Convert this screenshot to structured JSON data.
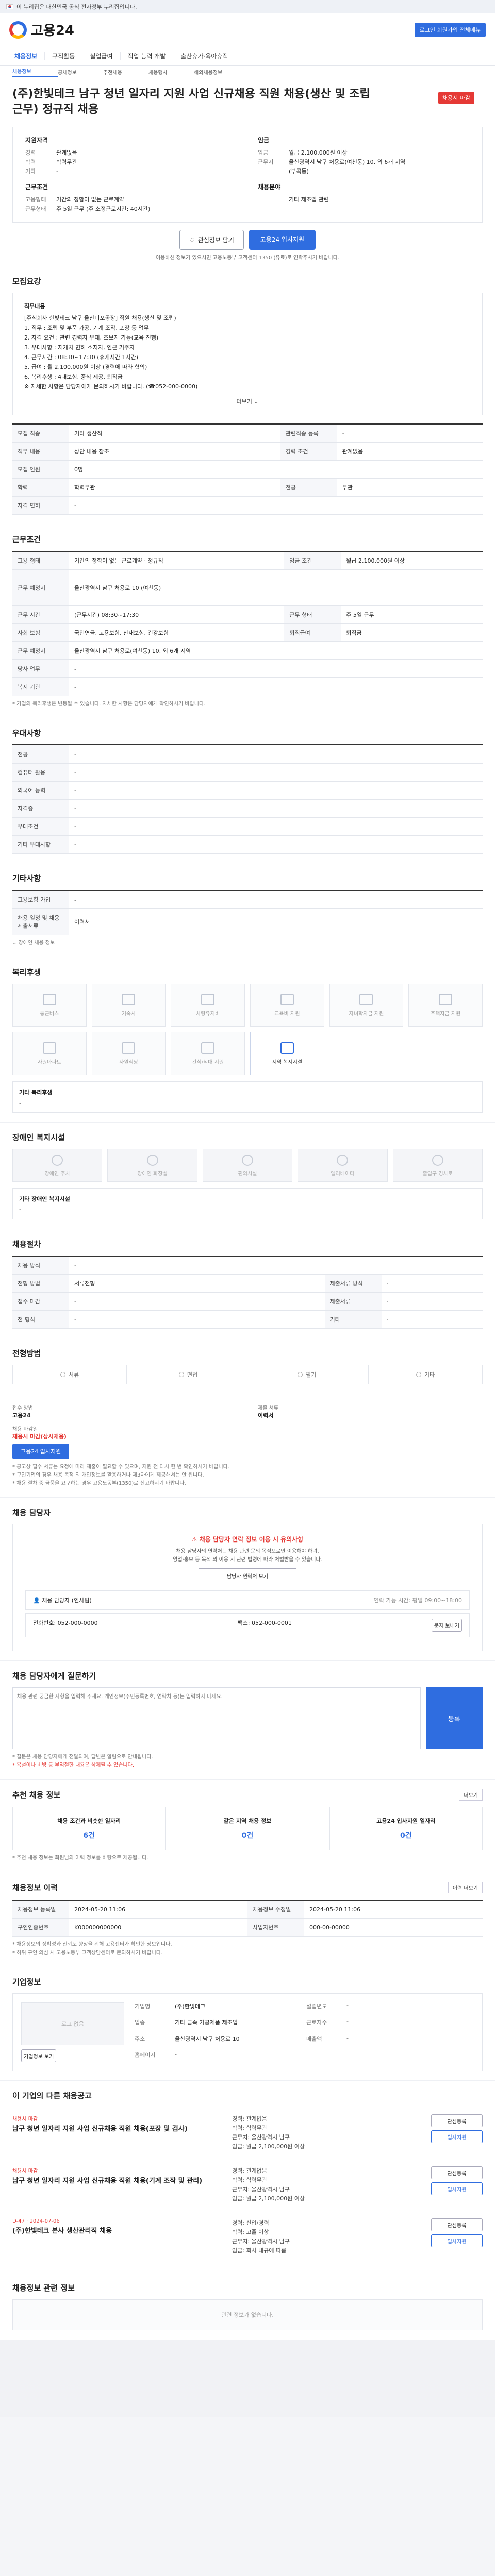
{
  "gov_banner": {
    "text": "이 누리집은 대한민국 공식 전자정부 누리집입니다.",
    "more": ""
  },
  "header": {
    "logo_text": "고용24",
    "login_label": "로그인 회원가입 전체메뉴"
  },
  "gnb": {
    "items": [
      "채용정보",
      "구직활동",
      "실업급여",
      "직업 능력 개발",
      "출산휴가·육아휴직"
    ]
  },
  "subnav": {
    "items": [
      "채용정보",
      "공채정보",
      "추천채용",
      "채용행사",
      "해외채용정보"
    ]
  },
  "job": {
    "title": "(주)한빛테크 남구 청년 일자리 지원 사업 신규채용 직원 채용(생산 및 조립 근무) 정규직 채용",
    "deadline": "채용시 마감"
  },
  "summary": {
    "left_title": "지원자격",
    "left_rows": [
      {
        "k": "경력",
        "v": "관계없음"
      },
      {
        "k": "학력",
        "v": "학력무관"
      },
      {
        "k": "기타",
        "v": "-"
      }
    ],
    "left2_title": "근무조건",
    "left2_rows": [
      {
        "k": "고용형태",
        "v": "기간의 정함이 없는 근로계약"
      },
      {
        "k": "근무형태",
        "v": "주 5일 근무 (주 소정근로시간: 40시간)"
      }
    ],
    "right_title": "임금",
    "right_rows": [
      {
        "k": "임금",
        "v": "월급 2,100,000원 이상"
      },
      {
        "k": "근무지",
        "v": "울산광역시 남구 처용로(여천동) 10, 외 6개 지역"
      },
      {
        "k": "",
        "v": "(부곡동)"
      }
    ],
    "right2_title": "채용분야",
    "right2_rows": [
      {
        "k": "",
        "v": "기타 제조업 관련"
      }
    ],
    "btn_scrap": "관심정보 담기",
    "btn_apply": "고용24 입사지원",
    "notice": "이용하신 정보가 있으시면 고용노동부 고객센터 1350 (유료)로 연락주시기 바랍니다."
  },
  "recruit": {
    "title": "모집요강",
    "desc_head": "직무내용",
    "desc_lines": [
      "[주식회사 한빛테크 남구 울산미포공장] 직원 채용(생산 및 조립)",
      "1. 직무 : 조립 및 부품 가공, 기계 조작, 포장 등 업무",
      "2. 자격 요건 : 관련 경력자 우대, 초보자 가능(교육 진행)",
      "3. 우대사항 : 지게차 면허 소지자, 인근 거주자",
      "4. 근무시간 : 08:30~17:30 (휴게시간 1시간)",
      "5. 급여 : 월 2,100,000원 이상 (경력에 따라 협의)",
      "6. 복리후생 : 4대보험, 중식 제공, 퇴직금",
      "※ 자세한 사항은 담당자에게 문의하시기 바랍니다. (☎052-000-0000)"
    ],
    "toggle": "더보기",
    "rows": [
      {
        "k": "모집 직종",
        "v": "기타 생산직",
        "k2": "관련직종 등록",
        "v2": "-"
      },
      {
        "k": "직무 내용",
        "v": "상단 내용 참조",
        "k2": "경력 조건",
        "v2": "관계없음"
      },
      {
        "k": "모집 인원",
        "v": "0명",
        "k2": "",
        "v2": ""
      },
      {
        "k": "학력",
        "v": "학력무관",
        "k2": "전공",
        "v2": "무관"
      },
      {
        "k": "자격 면허",
        "v": "-",
        "k2": "",
        "v2": ""
      }
    ]
  },
  "conditions": {
    "title": "근무조건",
    "rows": [
      {
        "k": "고용 형태",
        "v": "기간의 정함이 없는 근로계약 · 정규직",
        "k2": "임금 조건",
        "v2": "월급 2,100,000원 이상"
      },
      {
        "k": "근무 예정지",
        "v": "울산광역시 남구 처용로 10 (여천동)",
        "k2": "",
        "v2": ""
      },
      {
        "k": "근무 시간",
        "v": "(근무시간) 08:30~17:30",
        "k2": "근무 형태",
        "v2": "주 5일 근무"
      },
      {
        "k": "사회 보험",
        "v": "국민연금, 고용보험, 산재보험, 건강보험",
        "k2": "퇴직급여",
        "v2": "퇴직금"
      },
      {
        "k": "근무 예정지",
        "v": "울산광역시 남구 처용로(여천동) 10, 외 6개 지역",
        "k2": "",
        "v2": ""
      },
      {
        "k": "당사 업무",
        "v": "-",
        "k2": "",
        "v2": ""
      },
      {
        "k": "복지 기관",
        "v": "-",
        "k2": "",
        "v2": ""
      }
    ],
    "footnote": "* 기업의 복리후생은 변동될 수 있습니다. 자세한 사항은 담당자에게 확인하시기 바랍니다."
  },
  "preference": {
    "title": "우대사항",
    "rows": [
      {
        "k": "전공",
        "v": "-"
      },
      {
        "k": "컴퓨터 활용",
        "v": "-"
      },
      {
        "k": "외국어 능력",
        "v": "-"
      },
      {
        "k": "자격증",
        "v": "-"
      },
      {
        "k": "우대조건",
        "v": "-"
      },
      {
        "k": "기타 우대사항",
        "v": "-"
      }
    ]
  },
  "other_cond": {
    "title": "기타사항",
    "rows": [
      {
        "k": "고용보험 가입",
        "v": "-"
      },
      {
        "k": "채용 일정 및 채용 제출서류",
        "v": "이력서"
      }
    ],
    "link": "장애인 채용 정보"
  },
  "facility": {
    "title": "복리후생",
    "items": [
      "통근버스",
      "기숙사",
      "차량유지비",
      "교육비 지원",
      "자녀학자금 지원",
      "주택자금 지원",
      "사원아파트",
      "사원식당",
      "간식/식대 지원",
      "지역 복지시설"
    ],
    "active_index": 9,
    "text_title": "기타 복리후생",
    "text": "-"
  },
  "welfare": {
    "title": "장애인 복지시설",
    "items": [
      "장애인 주차",
      "장애인 화장실",
      "편의시설",
      "엘리베이터",
      "출입구 경사로"
    ],
    "text_title": "기타 장애인 복지시설",
    "text": "-"
  },
  "hire": {
    "title": "채용절차",
    "rows": [
      {
        "k": "채용 방식",
        "v": "-"
      },
      {
        "k": "전형 방법",
        "v": "서류전형",
        "k2": "제출서류 방식",
        "v2": "-"
      },
      {
        "k": "접수 마감",
        "v": "-",
        "k2": "제출서류",
        "v2": "-"
      },
      {
        "k": "전 형식",
        "v": "-",
        "k2": "기타",
        "v2": "-"
      }
    ]
  },
  "method": {
    "title": "전형방법",
    "items": [
      "서류",
      "면접",
      "필기",
      "기타"
    ]
  },
  "apply": {
    "k1": "접수 방법",
    "v1": "고용24",
    "k2": "제출 서류",
    "v2": "이력서",
    "k3": "채용 마감일",
    "v3": "채용시 마감(상시채용)",
    "k4": "",
    "v4": "",
    "btn": "고용24 입사지원",
    "notes": [
      "* 공고상 필수 서류는 요청에 따라 제출이 필요할 수 있으며, 지원 전 다시 한 번 확인하시기 바랍니다.",
      "* 구인기업의 경우 채용 목적 외 개인정보를 활용하거나 제3자에게 제공해서는 안 됩니다.",
      "* 채용 절차 중 금품을 요구하는 경우 고용노동부(1350)로 신고하시기 바랍니다."
    ]
  },
  "manager": {
    "title": "채용 담당자",
    "alert": "채용 담당자 연락 정보 이용 시 유의사항",
    "text1": "채용 담당자의 연락처는 채용 관련 문의 목적으로만 이용해야 하며,",
    "text2": "영업·홍보 등 목적 외 이용 시 관련 법령에 따라 처벌받을 수 있습니다.",
    "btn": "담당자 연락처 보기",
    "name": "채용 담당자 (인사팀)",
    "name_note": "연락 가능 시간: 평일 09:00~18:00",
    "phone": "전화번호: 052-000-0000",
    "fax": "팩스: 052-000-0001",
    "msg": "문자 보내기"
  },
  "qa": {
    "title": "채용 담당자에게 질문하기",
    "placeholder": "채용 관련 궁금한 사항을 입력해 주세요. 개인정보(주민등록번호, 연락처 등)는 입력하지 마세요.",
    "btn": "등록",
    "note1": "* 질문은 채용 담당자에게 전달되며, 답변은 알림으로 안내됩니다.",
    "note2": "* 욕설이나 비방 등 부적절한 내용은 삭제될 수 있습니다."
  },
  "recommend": {
    "title": "추천 채용 정보",
    "link": "더보기",
    "cards": [
      {
        "t": "채용 조건과 비슷한 일자리",
        "c": "6건"
      },
      {
        "t": "같은 지역 채용 정보",
        "c": "0건"
      },
      {
        "t": "고용24 입사지원 일자리",
        "c": "0건"
      }
    ],
    "note": "* 추천 채용 정보는 회원님의 이력 정보를 바탕으로 제공됩니다."
  },
  "regist": {
    "title": "채용정보 이력",
    "link": "이력 더보기",
    "rows": [
      {
        "k": "채용정보 등록일",
        "v": "2024-05-20 11:06",
        "k2": "채용정보 수정일",
        "v2": "2024-05-20 11:06"
      },
      {
        "k": "구인인증번호",
        "v": "K000000000000",
        "k2": "사업자번호",
        "v2": "000-00-00000"
      }
    ],
    "notes": [
      "* 채용정보의 정확성과 신뢰도 향상을 위해 고용센터가 확인한 정보입니다.",
      "* 허위 구인 의심 시 고용노동부 고객상담센터로 문의하시기 바랍니다."
    ]
  },
  "company": {
    "title": "기업정보",
    "logo": "로고 없음",
    "btn": "기업정보 보기",
    "rows": [
      {
        "k": "기업명",
        "v": "(주)한빛테크",
        "k2": "설립년도",
        "v2": "-"
      },
      {
        "k": "업종",
        "v": "기타 금속 가공제품 제조업",
        "k2": "근로자수",
        "v2": "-"
      },
      {
        "k": "주소",
        "v": "울산광역시 남구 처용로 10",
        "k2": "매출액",
        "v2": "-"
      },
      {
        "k": "홈페이지",
        "v": "-",
        "k2": "",
        "v2": ""
      }
    ]
  },
  "others": {
    "title": "이 기업의 다른 채용공고",
    "items": [
      {
        "tag": "채용시 마감",
        "title": "남구 청년 일자리 지원 사업 신규채용 직원 채용(포장 및 검사)",
        "meta1": "경력: 관계없음",
        "meta2": "학력: 학력무관",
        "meta3": "근무지: 울산광역시 남구",
        "meta4": "임금: 월급 2,100,000원 이상",
        "btn1": "관심등록",
        "btn2": "입사지원"
      },
      {
        "tag": "채용시 마감",
        "title": "남구 청년 일자리 지원 사업 신규채용 직원 채용(기계 조작 및 관리)",
        "meta1": "경력: 관계없음",
        "meta2": "학력: 학력무관",
        "meta3": "근무지: 울산광역시 남구",
        "meta4": "임금: 월급 2,100,000원 이상",
        "btn1": "관심등록",
        "btn2": "입사지원"
      },
      {
        "tag": "D-47 · 2024-07-06",
        "title": "(주)한빛테크 본사 생산관리직 채용",
        "meta1": "경력: 신입/경력",
        "meta2": "학력: 고졸 이상",
        "meta3": "근무지: 울산광역시 남구",
        "meta4": "임금: 회사 내규에 따름",
        "btn1": "관심등록",
        "btn2": "입사지원"
      }
    ]
  },
  "related": {
    "title": "채용정보 관련 정보",
    "empty": "관련 정보가 없습니다."
  }
}
